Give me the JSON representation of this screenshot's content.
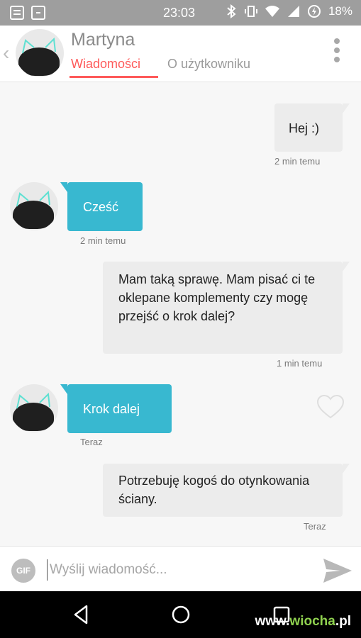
{
  "status_bar": {
    "time": "23:03",
    "battery": "18%"
  },
  "header": {
    "contact_name": "Martyna",
    "tabs": [
      {
        "label": "Wiadomości"
      },
      {
        "label": "O użytkowniku"
      }
    ]
  },
  "messages": [
    {
      "text": "Hej :)",
      "time": "2 min temu"
    },
    {
      "text": "Cześć",
      "time": "2 min temu"
    },
    {
      "text": "Mam taką sprawę. Mam pisać ci te oklepane komplementy czy mogę przejść o krok dalej?",
      "time": "1 min temu"
    },
    {
      "text": "Krok dalej",
      "time": "Teraz"
    },
    {
      "text": "Potrzebuję kogoś do otynkowania ściany.",
      "time": "Teraz"
    }
  ],
  "composer": {
    "gif_label": "GIF",
    "placeholder": "Wyślij wiadomość..."
  },
  "watermark": {
    "prefix": "www.",
    "brand": "wiocha",
    "suffix": ".pl"
  },
  "colors": {
    "accent": "#fe5a5a",
    "incoming_bubble": "#38b8d0",
    "outgoing_bubble": "#ececec"
  }
}
